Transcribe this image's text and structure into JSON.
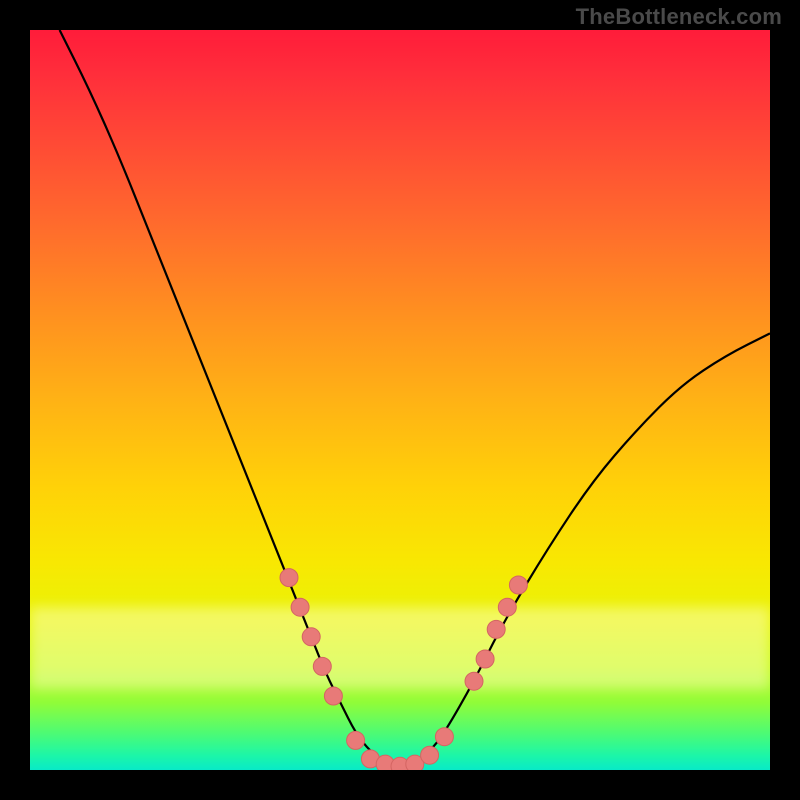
{
  "watermark": "TheBottleneck.com",
  "chart_data": {
    "type": "line",
    "title": "",
    "xlabel": "",
    "ylabel": "",
    "xlim": [
      0,
      100
    ],
    "ylim": [
      0,
      100
    ],
    "grid": false,
    "series": [
      {
        "name": "bottleneck-curve",
        "x": [
          4,
          8,
          12,
          16,
          20,
          24,
          28,
          32,
          36,
          38,
          40,
          42,
          44,
          46,
          48,
          50,
          52,
          54,
          56,
          60,
          64,
          70,
          76,
          82,
          88,
          94,
          100
        ],
        "y": [
          100,
          92,
          83,
          73,
          63,
          53,
          43,
          33,
          23,
          18,
          13,
          9,
          5,
          2.5,
          1,
          0.5,
          1,
          2.5,
          5,
          12,
          20,
          30,
          39,
          46,
          52,
          56,
          59
        ]
      }
    ],
    "markers": {
      "name": "highlight-points",
      "points": [
        [
          35,
          26
        ],
        [
          36.5,
          22
        ],
        [
          38,
          18
        ],
        [
          39.5,
          14
        ],
        [
          41,
          10
        ],
        [
          44,
          4
        ],
        [
          46,
          1.5
        ],
        [
          48,
          0.8
        ],
        [
          50,
          0.5
        ],
        [
          52,
          0.8
        ],
        [
          54,
          2
        ],
        [
          56,
          4.5
        ],
        [
          60,
          12
        ],
        [
          61.5,
          15
        ],
        [
          63,
          19
        ],
        [
          64.5,
          22
        ],
        [
          66,
          25
        ]
      ]
    }
  }
}
